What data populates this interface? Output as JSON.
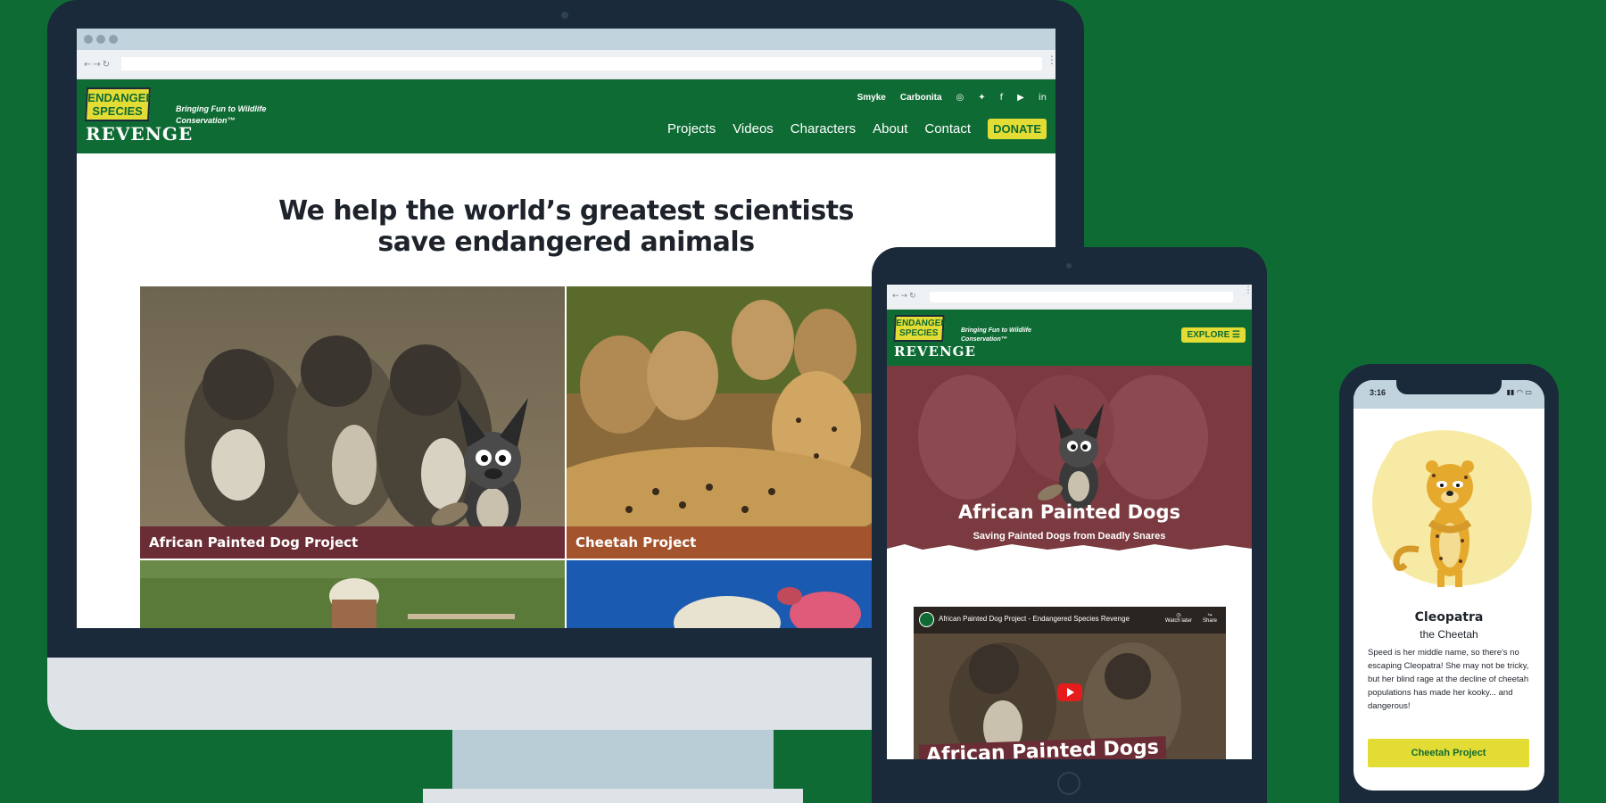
{
  "desktop": {
    "logo": {
      "top": "ENDANGERED SPECIES",
      "bottom": "REVENGE"
    },
    "tagline": "Bringing Fun to Wildlife Conservation™",
    "util_nav": [
      "Smyke",
      "Carbonita"
    ],
    "social_icons": [
      "instagram-icon",
      "twitter-icon",
      "facebook-icon",
      "youtube-icon",
      "linkedin-icon"
    ],
    "main_nav": [
      "Projects",
      "Videos",
      "Characters",
      "About",
      "Contact"
    ],
    "donate_label": "DONATE",
    "heading_line1": "We help the world’s greatest scientists",
    "heading_line2": "save endangered animals",
    "projects": [
      {
        "label": "African Painted Dog Project",
        "color": "#6b2d35"
      },
      {
        "label": "Cheetah Project",
        "color": "#a4542d"
      }
    ]
  },
  "tablet": {
    "logo": {
      "top": "ENDANGERED SPECIES",
      "bottom": "REVENGE"
    },
    "tagline": "Bringing Fun to Wildlife Conservation™",
    "explore_label": "EXPLORE ☰",
    "hero_title": "African Painted Dogs",
    "hero_subtitle": "Saving Painted Dogs from Deadly Snares",
    "video": {
      "title": "African Painted Dog Project - Endangered Species Revenge",
      "watch_later": "Watch later",
      "share": "Share",
      "caption": "African Painted Dogs"
    }
  },
  "phone": {
    "time": "3:16",
    "character_name": "Cleopatra",
    "character_subtitle": "the Cheetah",
    "description": "Speed is her middle name, so there's no escaping Cleopatra! She may not be tricky, but her blind rage at the decline of cheetah populations has made her kooky... and dangerous!",
    "button_label": "Cheetah Project"
  },
  "colors": {
    "brand_green": "#0f6b34",
    "accent_yellow": "#e3dc34",
    "device_dark": "#1a2a3a",
    "dog_maroon": "#6b2d35",
    "cheetah_orange": "#a4542d"
  }
}
